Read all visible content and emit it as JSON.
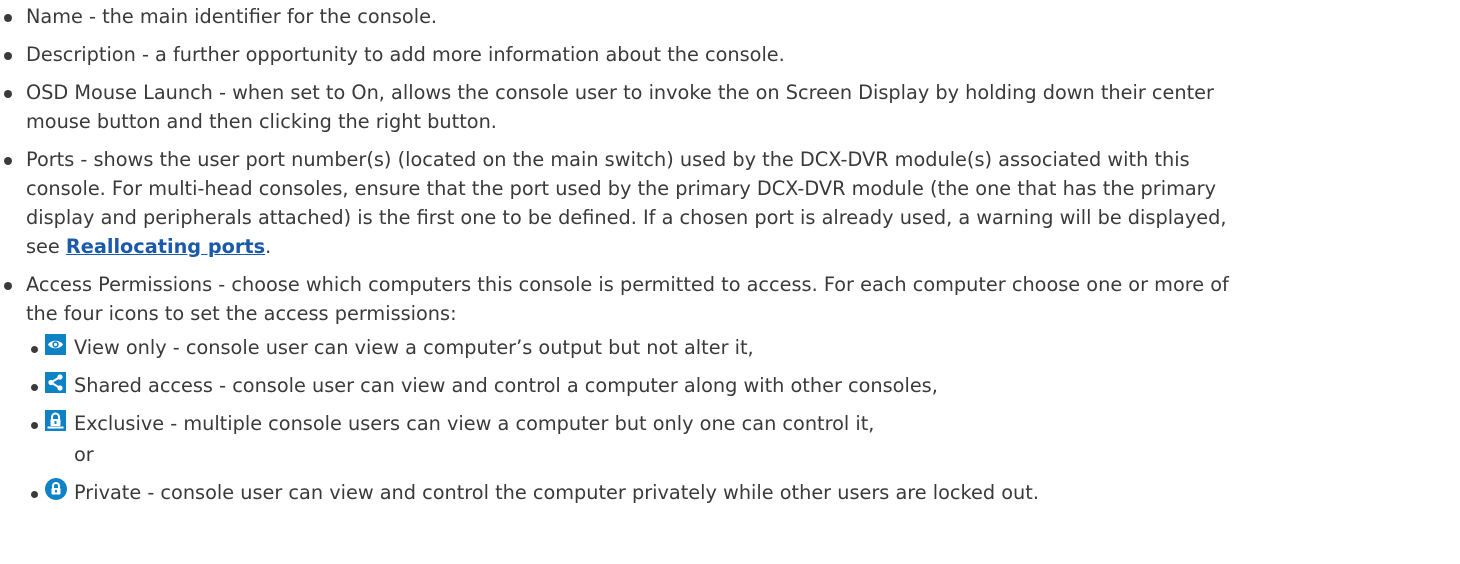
{
  "bullets": [
    {
      "text": "Name - the main identifier for the console."
    },
    {
      "text": "Description - a further opportunity to add more information about the console."
    },
    {
      "text": "OSD Mouse Launch - when set to On, allows the console user to invoke the on Screen Display by holding down their center",
      "text_line2": "mouse button and then clicking the right button."
    },
    {
      "text": "Ports - shows the user port number(s) (located on the main switch) used by the DCX-DVR module(s) associated with this",
      "text_line2": "console. For multi-head consoles, ensure that the port used by the primary DCX-DVR module (the one that has the primary",
      "text_line3": "display and peripherals attached) is the first one to be defined. If a chosen port is already used, a warning will be displayed,",
      "text_line4_prefix": "see ",
      "link": "Reallocating ports",
      "text_line4_suffix": "."
    },
    {
      "text": "Access Permissions - choose which computers this console is permitted to access. For each computer choose one or more of",
      "text_line2": "the four icons to set the access permissions:"
    }
  ],
  "permissions": [
    {
      "icon": "eye-icon",
      "text": "View only - console user can view a computer’s output but not alter it,"
    },
    {
      "icon": "share-icon",
      "text": "Shared access - console user can view and control a computer along with other consoles,"
    },
    {
      "icon": "exclusive-lock-icon",
      "text": "Exclusive - multiple console users can view a computer but only one can control it,"
    },
    {
      "icon": "private-lock-icon",
      "text": "Private - console user can view and control the computer privately while other users are locked out."
    }
  ],
  "or_text": "or",
  "colors": {
    "text": "#3a3a3a",
    "link": "#1a5aa8",
    "icon_bg": "#0d83c6"
  }
}
